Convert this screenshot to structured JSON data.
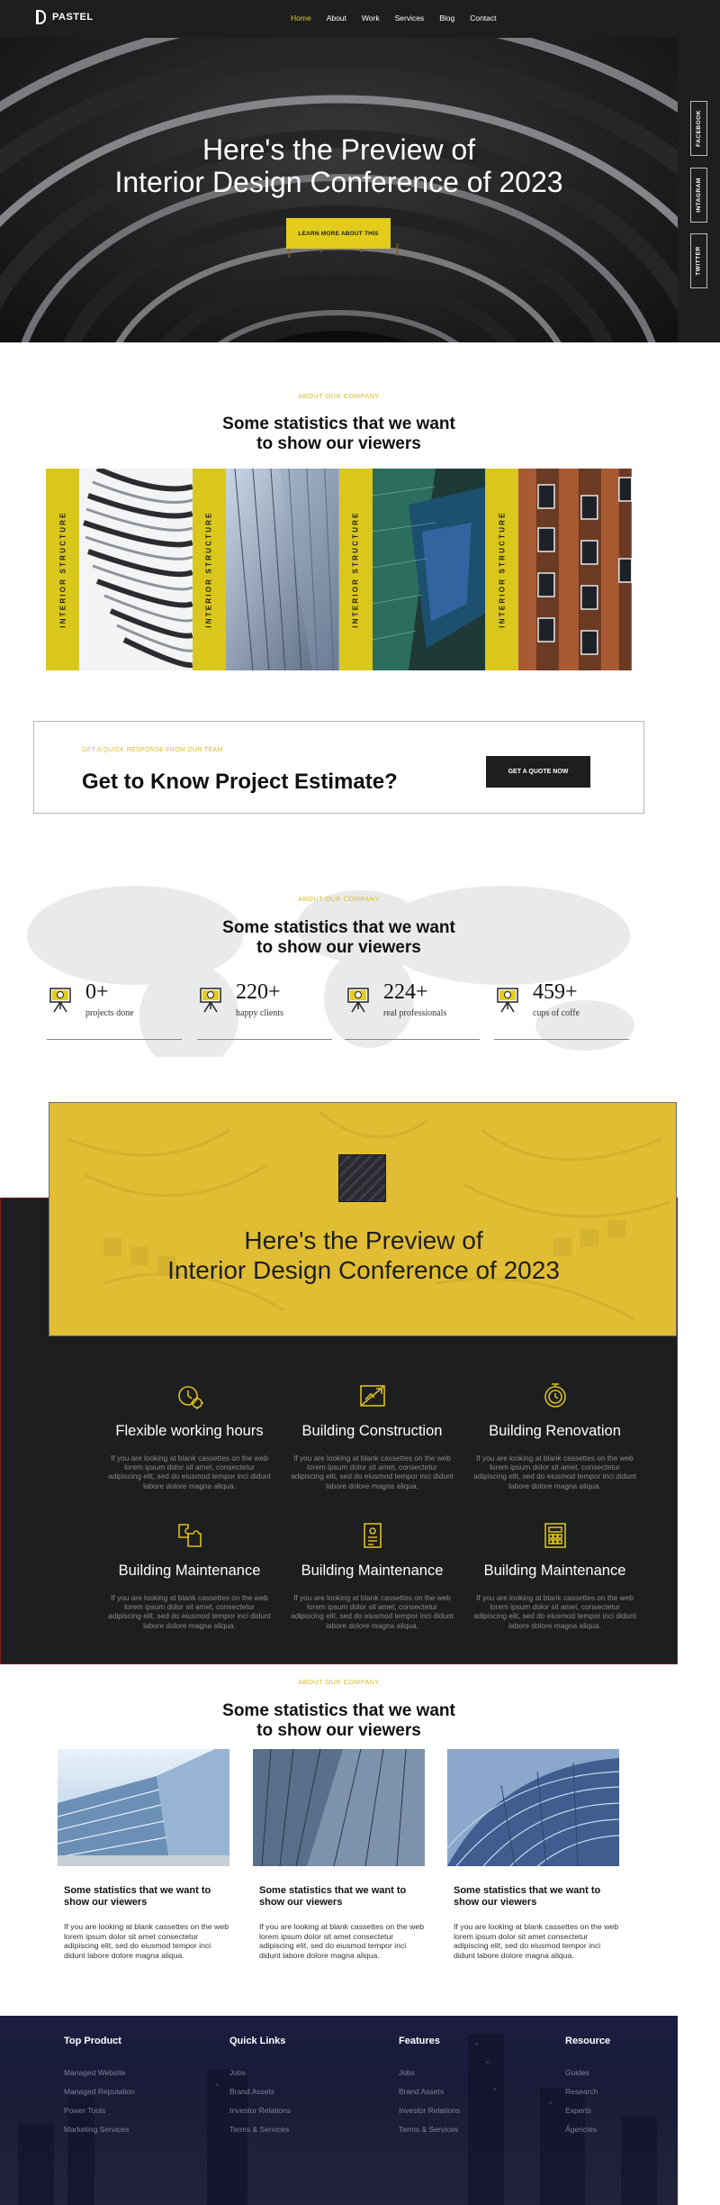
{
  "nav": {
    "logo_text": "PASTEL",
    "items": [
      {
        "label": "Home",
        "active": true
      },
      {
        "label": "About"
      },
      {
        "label": "Work"
      },
      {
        "label": "Services"
      },
      {
        "label": "Blog"
      },
      {
        "label": "Contact"
      }
    ]
  },
  "hero": {
    "title_line1": "Here's the Preview of",
    "title_line2": "Interior Design Conference of 2023",
    "button_label": "LEARN MORE ABOUT THIS"
  },
  "social": {
    "facebook": "FACEBOOK",
    "instagram": "INTAGRAM",
    "twitter": "TWITTER"
  },
  "about": {
    "eyebrow": "ABOUT OUR COMPANY",
    "title_line1": "Some statistics that we want",
    "title_line2": "to show our viewers"
  },
  "gallery": {
    "cards": [
      {
        "label": "INTERIOR STRUCTURE"
      },
      {
        "label": "INTERIOR STRUCTURE"
      },
      {
        "label": "INTERIOR STRUCTURE"
      },
      {
        "label": "INTERIOR STRUCTURE"
      }
    ]
  },
  "estimate": {
    "eyebrow": "GET A QUICK RESPONSE FROM OUR TEAM",
    "title": "Get to Know Project Estimate?",
    "button_label": "GET A QUOTE NOW"
  },
  "stats": {
    "eyebrow": "ABOUT OUR COMPANY",
    "title_line1": "Some statistics that we want",
    "title_line2": "to show our viewers",
    "items": [
      {
        "value": "0+",
        "label": "projects done"
      },
      {
        "value": "220+",
        "label": "happy clients"
      },
      {
        "value": "224+",
        "label": "real professionals"
      },
      {
        "value": "459+",
        "label": "cups of coffe"
      }
    ]
  },
  "preview": {
    "title_line1": "Here's the Preview of",
    "title_line2": "Interior Design Conference of 2023"
  },
  "services": {
    "items": [
      {
        "title": "Flexible working hours",
        "icon": "clock-gear-icon",
        "text": "If you are looking at blank cassettes on the web lorem ipsum dolor sit amet, consectetur adipiscing elit, sed do eiusmod tempor inci didunt labore dolore magna aliqua."
      },
      {
        "title": "Building Construction",
        "icon": "blueprint-icon",
        "text": "If you are looking at blank cassettes on the web lorem ipsum dolor sit amet, consectetur adipiscing elit, sed do eiusmod tempor inci didunt labore dolore magna aliqua."
      },
      {
        "title": "Building Renovation",
        "icon": "renovation-clock-icon",
        "text": "If you are looking at blank cassettes on the web lorem ipsum dolor sit amet, consectetur adipiscing elit, sed do eiusmod tempor inci didunt labore dolore magna aliqua."
      },
      {
        "title": "Building Maintenance",
        "icon": "puzzle-icon",
        "text": "If you are looking at blank cassettes on the web lorem ipsum dolor sit amet, consectetur adipiscing elit, sed do eiusmod tempor inci didunt labore dolore magna aliqua."
      },
      {
        "title": "Building Maintenance",
        "icon": "document-icon",
        "text": "If you are looking at blank cassettes on the web lorem ipsum dolor sit amet, consectetur adipiscing elit, sed do eiusmod tempor inci didunt labore dolore magna aliqua."
      },
      {
        "title": "Building Maintenance",
        "icon": "calculator-icon",
        "text": "If you are looking at blank cassettes on the web lorem ipsum dolor sit amet, consectetur adipiscing elit, sed do eiusmod tempor inci didunt labore dolore magna aliqua."
      }
    ]
  },
  "blog": {
    "eyebrow": "ABOUT OUR COMPANY",
    "title_line1": "Some statistics that we want",
    "title_line2": "to show our viewers",
    "posts": [
      {
        "title": "Some statistics that we want to show our viewers",
        "text": "If you are looking at blank cassettes on the web lorem ipsum dolor sit amet consectetur adipiscing elit, sed do eiusmod tempor inci didunt labore dolore magna aliqua."
      },
      {
        "title": "Some statistics that we want to show our viewers",
        "text": "If you are looking at blank cassettes on the web lorem ipsum dolor sit amet consectetur adipiscing elit, sed do eiusmod tempor inci didunt labore dolore magna aliqua."
      },
      {
        "title": "Some statistics that we want to show our viewers",
        "text": "If you are looking at blank cassettes on the web lorem ipsum dolor sit amet consectetur adipiscing elit, sed do eiusmod tempor inci didunt labore dolore magna aliqua."
      }
    ]
  },
  "footer": {
    "columns": [
      {
        "heading": "Top Product",
        "links": [
          "Managed Website",
          "Managed Reputation",
          "Power Tools",
          "Marketing Services"
        ]
      },
      {
        "heading": "Quick Links",
        "links": [
          "Jobs",
          "Brand Assets",
          "Investor Relations",
          "Terms & Services"
        ]
      },
      {
        "heading": "Features",
        "links": [
          "Jobs",
          "Brand Assets",
          "Investor Relations",
          "Terms & Services"
        ]
      },
      {
        "heading": "Resource",
        "links": [
          "Guides",
          "Research",
          "Experts",
          "Agencies"
        ]
      }
    ]
  },
  "colors": {
    "accent": "#e3cc1c",
    "dark": "#1d1e20",
    "footer": "#1b1c40"
  }
}
